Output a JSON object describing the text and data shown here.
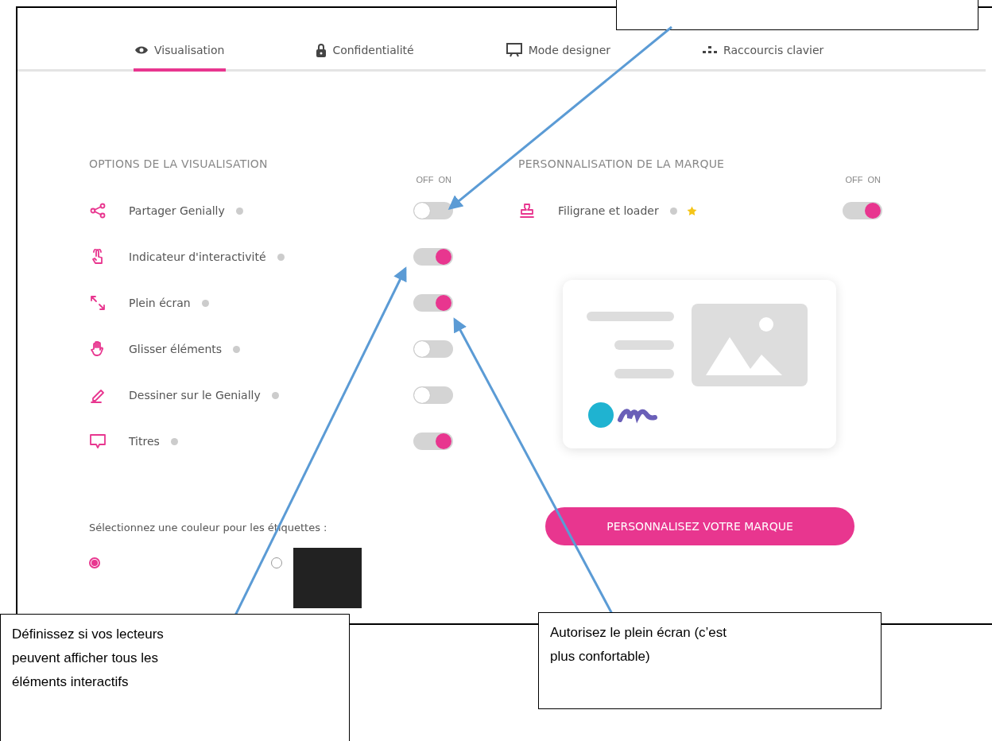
{
  "tabs": [
    {
      "label": "Visualisation",
      "selected": true
    },
    {
      "label": "Confidentialité",
      "selected": false
    },
    {
      "label": "Mode designer",
      "selected": false
    },
    {
      "label": "Raccourcis clavier",
      "selected": false
    }
  ],
  "display_options": {
    "title": "OPTIONS DE LA VISUALISATION",
    "off_label": "OFF",
    "on_label": "ON",
    "items": [
      {
        "label": "Partager Genially",
        "on": false
      },
      {
        "label": "Indicateur d'interactivité",
        "on": true
      },
      {
        "label": "Plein écran",
        "on": true
      },
      {
        "label": "Glisser éléments",
        "on": false
      },
      {
        "label": "Dessiner sur le Genially",
        "on": false
      },
      {
        "label": "Titres",
        "on": true
      }
    ]
  },
  "branding": {
    "title": "PERSONNALISATION DE LA MARQUE",
    "off_label": "OFF",
    "on_label": "ON",
    "items": [
      {
        "label": "Filigrane et loader",
        "on": true,
        "premium": true
      }
    ],
    "button": "PERSONNALISEZ VOTRE MARQUE"
  },
  "label_color": {
    "prompt": "Sélectionnez une couleur pour les étiquettes :",
    "options": [
      {
        "selected": true
      },
      {
        "selected": false,
        "color": "#222222"
      }
    ]
  },
  "callouts": [
    {
      "text": "Définissez si vos lecteurs peuvent afficher tous les éléments interactifs"
    },
    {
      "text": "Autorisez le plein écran (c’est plus confortable)"
    }
  ]
}
